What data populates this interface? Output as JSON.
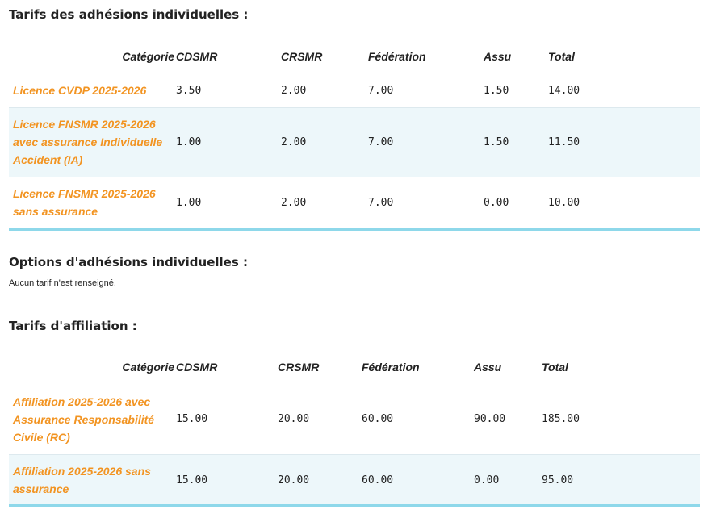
{
  "individual": {
    "title": "Tarifs des adhésions individuelles :",
    "headers": [
      "Catégorie",
      "CDSMR",
      "CRSMR",
      "Fédération",
      "Assu",
      "Total"
    ],
    "rows": [
      {
        "category": "Licence CVDP 2025-2026",
        "cdsmr": "3.50",
        "crsmr": "2.00",
        "federation": "7.00",
        "assu": "1.50",
        "total": "14.00"
      },
      {
        "category": "Licence FNSMR 2025-2026 avec assurance Individuelle Accident (IA)",
        "cdsmr": "1.00",
        "crsmr": "2.00",
        "federation": "7.00",
        "assu": "1.50",
        "total": "11.50"
      },
      {
        "category": "Licence FNSMR 2025-2026 sans assurance",
        "cdsmr": "1.00",
        "crsmr": "2.00",
        "federation": "7.00",
        "assu": "0.00",
        "total": "10.00"
      }
    ]
  },
  "options": {
    "title": "Options d'adhésions individuelles :",
    "empty_message": "Aucun tarif n'est renseigné."
  },
  "affiliation": {
    "title": "Tarifs d'affiliation :",
    "headers": [
      "Catégorie",
      "CDSMR",
      "CRSMR",
      "Fédération",
      "Assu",
      "Total"
    ],
    "rows": [
      {
        "category": "Affiliation 2025-2026 avec Assurance Responsabilité Civile (RC)",
        "cdsmr": "15.00",
        "crsmr": "20.00",
        "federation": "60.00",
        "assu": "90.00",
        "total": "185.00"
      },
      {
        "category": "Affiliation 2025-2026 sans assurance",
        "cdsmr": "15.00",
        "crsmr": "20.00",
        "federation": "60.00",
        "assu": "0.00",
        "total": "95.00"
      }
    ]
  },
  "colors": {
    "category_text": "#f29422",
    "alt_row_bg": "#edf7fa",
    "bottom_rule": "#8ed8ea"
  }
}
